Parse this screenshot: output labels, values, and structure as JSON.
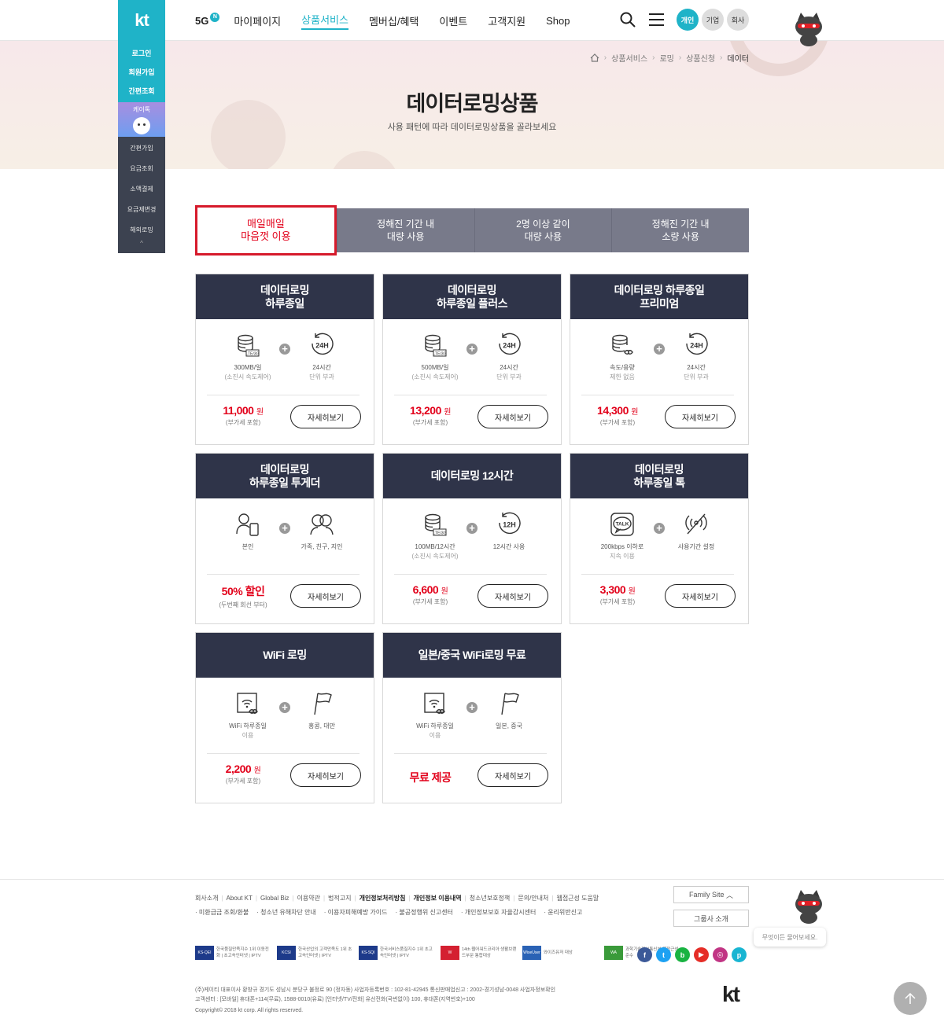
{
  "header": {
    "logo": "kt",
    "nav": [
      {
        "label": "5G",
        "badge": "N"
      },
      {
        "label": "마이페이지"
      },
      {
        "label": "상품서비스"
      },
      {
        "label": "멤버십/혜택"
      },
      {
        "label": "이벤트"
      },
      {
        "label": "고객지원"
      },
      {
        "label": "Shop"
      }
    ],
    "segments": [
      "개인",
      "기업",
      "회사"
    ]
  },
  "quick_menu": {
    "top": [
      "로그인",
      "회원가입",
      "간편조회"
    ],
    "katalk": "케이톡",
    "bottom": [
      "간편가입",
      "요금조회",
      "소액결제",
      "요금제변경",
      "해외로밍"
    ],
    "arrow": "^"
  },
  "breadcrumb": [
    "상품서비스",
    "로밍",
    "상품신청",
    "데이터"
  ],
  "hero": {
    "title": "데이터로밍상품",
    "subtitle": "사용 패턴에 따라 데이터로밍상품을 골라보세요"
  },
  "tabs": [
    {
      "line1": "매일매일",
      "line2": "마음껏 이용"
    },
    {
      "line1": "정해진 기간 내",
      "line2": "대량 사용"
    },
    {
      "line1": "2명 이상 같이",
      "line2": "대량 사용"
    },
    {
      "line1": "정해진 기간 내",
      "line2": "소량 사용"
    }
  ],
  "cards": [
    {
      "title1": "데이터로밍",
      "title2": "하루종일",
      "f1a": "300MB/일",
      "f1b": "(소진시 속도제어)",
      "f2a": "24시간",
      "f2b": "단위 부과",
      "price": "11,000",
      "unit": "원",
      "note": "(부가세 포함)",
      "more": "자세히보기"
    },
    {
      "title1": "데이터로밍",
      "title2": "하루종일 플러스",
      "f1a": "500MB/일",
      "f1b": "(소진시 속도제어)",
      "f2a": "24시간",
      "f2b": "단위 부과",
      "price": "13,200",
      "unit": "원",
      "note": "(부가세 포함)",
      "more": "자세히보기"
    },
    {
      "title1": "데이터로밍 하루종일",
      "title2": "프리미엄",
      "f1a": "속도/용량",
      "f1b": "제한 없음",
      "f2a": "24시간",
      "f2b": "단위 부과",
      "price": "14,300",
      "unit": "원",
      "note": "(부가세 포함)",
      "more": "자세히보기"
    },
    {
      "title1": "데이터로밍",
      "title2": "하루종일 투게더",
      "f1a": "본인",
      "f1b": "",
      "f2a": "가족, 친구, 지인",
      "f2b": "",
      "price": "50% 할인",
      "unit": "",
      "note": "(두번째 회선 부터)",
      "more": "자세히보기"
    },
    {
      "title1": "데이터로밍 12시간",
      "title2": "",
      "f1a": "100MB/12시간",
      "f1b": "(소진시 속도제어)",
      "f2a": "12시간 사용",
      "f2b": "",
      "price": "6,600",
      "unit": "원",
      "note": "(부가세 포함)",
      "more": "자세히보기"
    },
    {
      "title1": "데이터로밍",
      "title2": "하루종일 톡",
      "f1a": "200kbps 이하로",
      "f1b": "지속 이용",
      "f2a": "사용기간 설정",
      "f2b": "",
      "price": "3,300",
      "unit": "원",
      "note": "(부가세 포함)",
      "more": "자세히보기"
    },
    {
      "title1": "WiFi 로밍",
      "title2": "",
      "f1a": "WiFi 하루종일",
      "f1b": "이용",
      "f2a": "홍콩, 대만",
      "f2b": "",
      "price": "2,200",
      "unit": "원",
      "note": "(부가세 포함)",
      "more": "자세히보기"
    },
    {
      "title1": "일본/중국 WiFi로밍 무료",
      "title2": "",
      "f1a": "WiFi 하루종일",
      "f1b": "이용",
      "f2a": "일본, 중국",
      "f2b": "",
      "price": "무료 제공",
      "unit": "",
      "note": "",
      "more": "자세히보기"
    }
  ],
  "card_icons": [
    [
      "lte-coins-icon",
      "24h-icon"
    ],
    [
      "lte-coins-icon",
      "24h-icon"
    ],
    [
      "infinity-coins-icon",
      "24h-icon"
    ],
    [
      "person-phone-icon",
      "people-icon"
    ],
    [
      "lte-coins-icon",
      "12h-icon"
    ],
    [
      "talk-icon",
      "no-signal-icon"
    ],
    [
      "wifi-box-icon",
      "flag-icon"
    ],
    [
      "wifi-box-icon",
      "flag-icon"
    ]
  ],
  "footer": {
    "links1": [
      "회사소개",
      "About KT",
      "Global Biz",
      "이용약관",
      "법적고지",
      "개인정보처리방침",
      "개인정보 이용내역",
      "청소년보호정책",
      "문의/안내처",
      "웹접근성 도움말"
    ],
    "links1_bold": [
      false,
      false,
      false,
      false,
      false,
      true,
      true,
      false,
      false,
      false
    ],
    "links2": [
      "· 미환급금 조회/환불",
      "· 청소년 유해차단 안내",
      "· 이용자피해예방 가이드",
      "· 불공정행위 신고센터",
      "· 개인정보보호 자율감시센터",
      "· 윤리위반신고"
    ],
    "family_site": "Family Site",
    "group_intro": "그룹사 소개",
    "certs": [
      {
        "logo": "KS-QEI",
        "text": "한국품질만족지수 1위 이동전화 | 초고속인터넷 | IPTV"
      },
      {
        "logo": "KCSI",
        "text": "한국산업의 고객만족도 1위 초고속인터넷 | IPTV"
      },
      {
        "logo": "KS-SQI",
        "text": "한국서비스품질지수 1위 초고속인터넷 | IPTV"
      },
      {
        "logo": "W",
        "text": "14th 웹어워드코리아 생활브랜드부문 통합대상"
      },
      {
        "logo": "WiseUser",
        "text": "와이즈유저 대상"
      },
      {
        "logo": "WA",
        "text": "과학기술정보통신부 웹접근성 준수"
      }
    ],
    "sns": [
      "f",
      "t",
      "b",
      "▶",
      "◎",
      "p"
    ],
    "sns_colors": [
      "#3b5998",
      "#1da1f2",
      "#19b341",
      "#e52d27",
      "#c13584",
      "#18b5d2"
    ],
    "address1": "(주)케이티 대표이사 황창규  경기도 성남시 분당구 불정로 90 (정자동)  사업자등록번호 : 102-81-42945  통신판매업신고 : 2002-경기성남-0048  사업자정보확인",
    "address2": "고객센터 : [모바일] 휴대폰+114(무료), 1588-0010(유료)  [인터넷/TV/전화] 유선전화(국번없이) 100, 휴대폰(지역번호)+100",
    "copyright": "Copyright© 2018 kt corp. All rights reserved.",
    "logo": "kt",
    "chatbot": "무엇이든 물어보세요."
  }
}
